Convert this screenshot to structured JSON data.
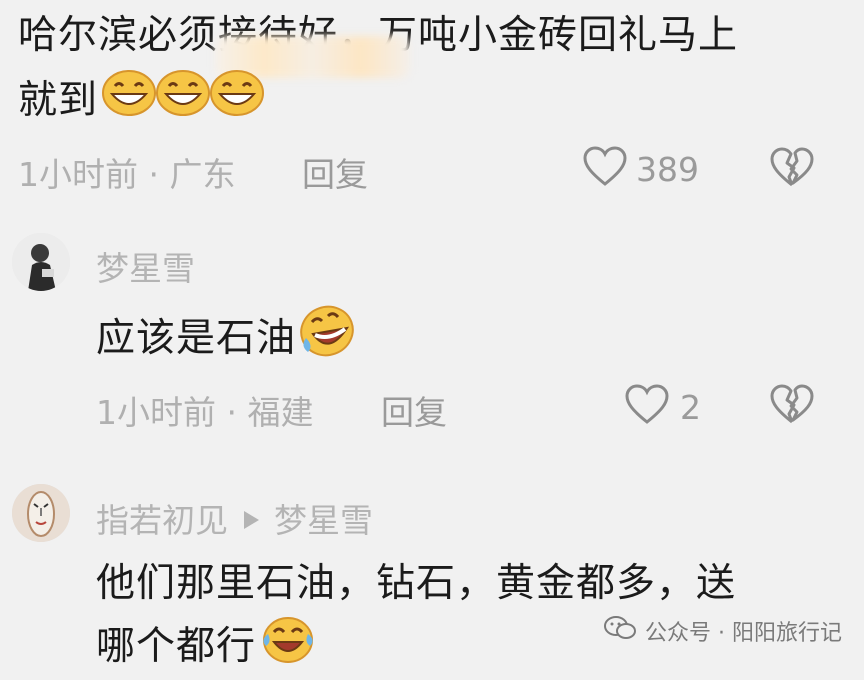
{
  "comment1": {
    "line1": "哈尔滨必须接待好，万吨小金砖回礼马上",
    "line2": "就到",
    "time_location": "1小时前 · 广东",
    "reply_label": "回复",
    "like_count": "389",
    "emoji": "grinning-face"
  },
  "comment2": {
    "username": "梦星雪",
    "text": "应该是石油",
    "time_location": "1小时前 · 福建",
    "reply_label": "回复",
    "like_count": "2",
    "emoji": "rolling-laughing-face"
  },
  "comment3": {
    "username": "指若初见",
    "reply_to": "梦星雪",
    "line1": "他们那里石油，钻石，黄金都多，送",
    "line2": "哪个都行",
    "emoji": "laughing-tears-face"
  },
  "watermark": "公众号 · 阳阳旅行记",
  "icons": [
    "heart-icon",
    "broken-heart-icon",
    "play-arrow-icon",
    "wechat-icon"
  ]
}
